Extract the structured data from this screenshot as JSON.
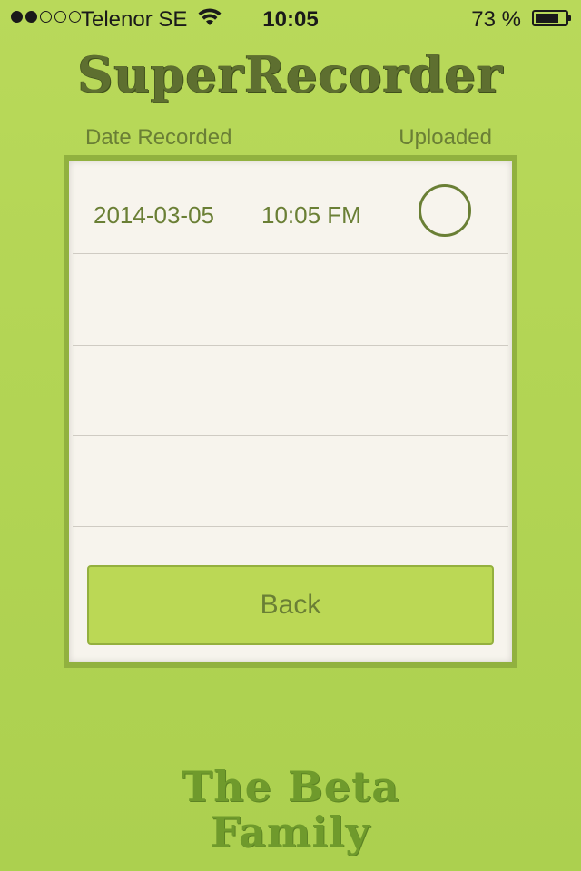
{
  "status_bar": {
    "signal_dots": [
      true,
      true,
      false,
      false,
      false
    ],
    "carrier": "Telenor SE",
    "time": "10:05",
    "battery_percent": "73 %",
    "battery_level": 0.73
  },
  "app": {
    "title": "SuperRecorder"
  },
  "table": {
    "columns": {
      "date": "Date Recorded",
      "uploaded": "Uploaded"
    },
    "rows": [
      {
        "date": "2014-03-05",
        "time": "10:05 FM",
        "uploaded": false
      },
      {
        "date": "",
        "time": "",
        "uploaded": null
      },
      {
        "date": "",
        "time": "",
        "uploaded": null
      },
      {
        "date": "",
        "time": "",
        "uploaded": null
      }
    ]
  },
  "buttons": {
    "back_label": "Back"
  },
  "footer": {
    "line1": "The Beta",
    "line2": "Family"
  },
  "colors": {
    "background": "#b3d555",
    "accent_text": "#6a7f35",
    "panel_border": "#91b13f",
    "panel_bg": "#f7f4ed",
    "button_bg": "#bbd855"
  },
  "icons": {
    "wifi": "wifi-icon",
    "battery": "battery-icon",
    "upload_status": "circle-outline-icon"
  }
}
